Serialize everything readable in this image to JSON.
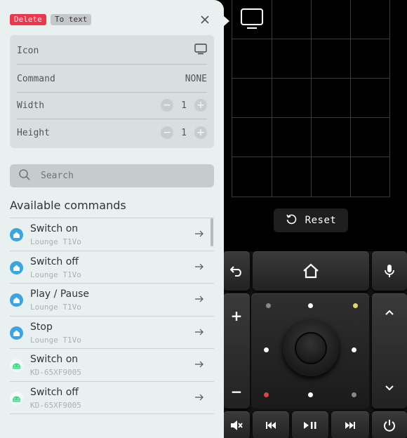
{
  "editor": {
    "delete_label": "Delete",
    "to_text_label": "To text",
    "icon_label": "Icon",
    "command_label": "Command",
    "command_value": "NONE",
    "width_label": "Width",
    "width_value": "1",
    "height_label": "Height",
    "height_value": "1",
    "minus_glyph": "−",
    "plus_glyph": "+"
  },
  "search": {
    "placeholder": "Search"
  },
  "commands": {
    "title": "Available commands",
    "items": [
      {
        "title": "Switch on",
        "device": "Lounge T1Vo",
        "icon": "home-assistant-icon"
      },
      {
        "title": "Switch off",
        "device": "Lounge T1Vo",
        "icon": "home-assistant-icon"
      },
      {
        "title": "Play / Pause",
        "device": "Lounge T1Vo",
        "icon": "home-assistant-icon"
      },
      {
        "title": "Stop",
        "device": "Lounge T1Vo",
        "icon": "home-assistant-icon"
      },
      {
        "title": "Switch on",
        "device": "KD-65XF9005",
        "icon": "android-icon"
      },
      {
        "title": "Switch off",
        "device": "KD-65XF9005",
        "icon": "android-icon"
      }
    ]
  },
  "canvas": {
    "reset_label": "Reset"
  },
  "colors": {
    "accent_delete": "#f0364c",
    "home_assistant": "#3ca4e0",
    "android": "#3ddc84",
    "panel_bg": "#e8f0f0"
  }
}
